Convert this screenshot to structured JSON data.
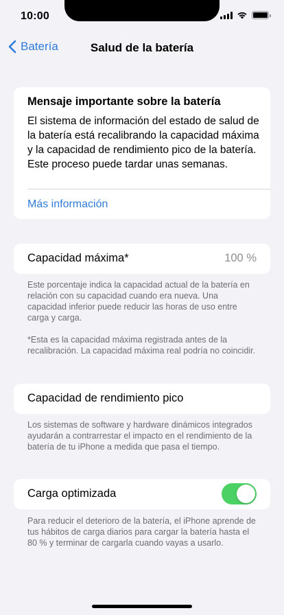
{
  "status_bar": {
    "time": "10:00"
  },
  "nav": {
    "back_label": "Batería",
    "title": "Salud de la batería"
  },
  "message_card": {
    "title": "Mensaje importante sobre la batería",
    "body": "El sistema de información del estado de salud de la batería está recalibrando la capacidad máxima y la capacidad de rendimiento pico de la batería. Este proceso puede tardar unas semanas.",
    "link": "Más información"
  },
  "max_capacity": {
    "label": "Capacidad máxima*",
    "value": "100 %",
    "footnote_1": "Este porcentaje indica la capacidad actual de la batería en relación con su capacidad cuando era nueva. Una capacidad inferior puede reducir las horas de uso entre carga y carga.",
    "footnote_2": "*Esta es la capacidad máxima registrada antes de la recalibración. La capacidad máxima real podría no coincidir."
  },
  "peak_performance": {
    "label": "Capacidad de rendimiento pico",
    "footnote": "Los sistemas de software y hardware dinámicos integrados ayudarán a contrarrestar el impacto en el rendimiento de la batería de tu iPhone a medida que pasa el tiempo."
  },
  "optimized_charging": {
    "label": "Carga optimizada",
    "enabled": true,
    "toggle_color": "#4cd264",
    "footnote": "Para reducir el deterioro de la batería, el iPhone aprende de tus hábitos de carga diarios para cargar la batería hasta el 80 % y terminar de cargarla cuando vayas a usarlo."
  },
  "colors": {
    "accent": "#2f7bd8",
    "background": "#f2f2f7",
    "secondary_text": "#6d6d72"
  },
  "icons": {
    "back": "chevron-left-icon",
    "signal": "cellular-signal-icon",
    "wifi": "wifi-icon",
    "battery": "battery-icon"
  }
}
